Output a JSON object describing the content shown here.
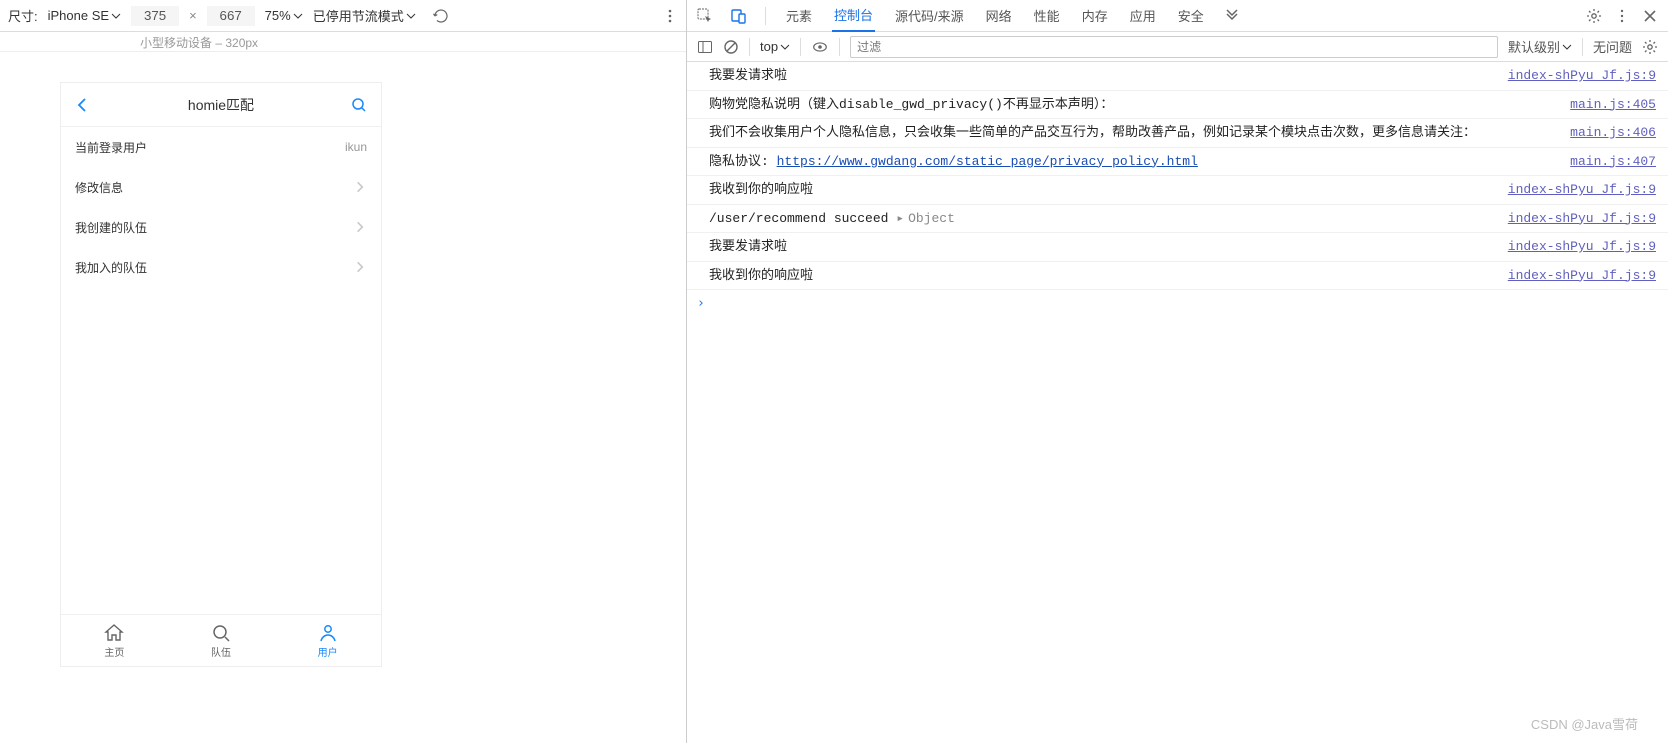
{
  "deviceToolbar": {
    "sizeLabel": "尺寸:",
    "deviceName": "iPhone SE",
    "width": "375",
    "x": "×",
    "height": "667",
    "zoom": "75%",
    "throttle": "已停用节流模式"
  },
  "ruler": {
    "label": "小型移动设备 – 320px"
  },
  "app": {
    "title": "homie匹配",
    "cells": [
      {
        "label": "当前登录用户",
        "value": "ikun",
        "chevron": false
      },
      {
        "label": "修改信息",
        "value": "",
        "chevron": true
      },
      {
        "label": "我创建的队伍",
        "value": "",
        "chevron": true
      },
      {
        "label": "我加入的队伍",
        "value": "",
        "chevron": true
      }
    ],
    "tabs": [
      {
        "label": "主页",
        "active": false
      },
      {
        "label": "队伍",
        "active": false
      },
      {
        "label": "用户",
        "active": true
      }
    ]
  },
  "devtools": {
    "tabs": [
      "元素",
      "控制台",
      "源代码/来源",
      "网络",
      "性能",
      "内存",
      "应用",
      "安全"
    ],
    "activeTab": "控制台",
    "consoleToolbar": {
      "context": "top",
      "filterPlaceholder": "过滤",
      "level": "默认级别",
      "issues": "无问题"
    },
    "logs": [
      {
        "msg": "我要发请求啦",
        "src": "index-shPyu_Jf.js:9"
      },
      {
        "msg": "购物党隐私说明（键入disable_gwd_privacy()不再显示本声明）：",
        "src": "main.js:405"
      },
      {
        "msg": "    我们不会收集用户个人隐私信息，只会收集一些简单的产品交互行为，帮助改善产品，例如记录某个模块点击次数，更多信息请关注：",
        "src": "main.js:406"
      },
      {
        "prefix": "隐私协议: ",
        "link": "https://www.gwdang.com/static_page/privacy_policy.html",
        "src": "main.js:407"
      },
      {
        "msg": "我收到你的响应啦",
        "src": "index-shPyu_Jf.js:9"
      },
      {
        "prefix": "/user/recommend succeed ",
        "object": "Object",
        "src": "index-shPyu_Jf.js:9"
      },
      {
        "msg": "我要发请求啦",
        "src": "index-shPyu_Jf.js:9"
      },
      {
        "msg": "我收到你的响应啦",
        "src": "index-shPyu_Jf.js:9"
      }
    ],
    "prompt": "›"
  },
  "watermark": "CSDN @Java雪荷"
}
